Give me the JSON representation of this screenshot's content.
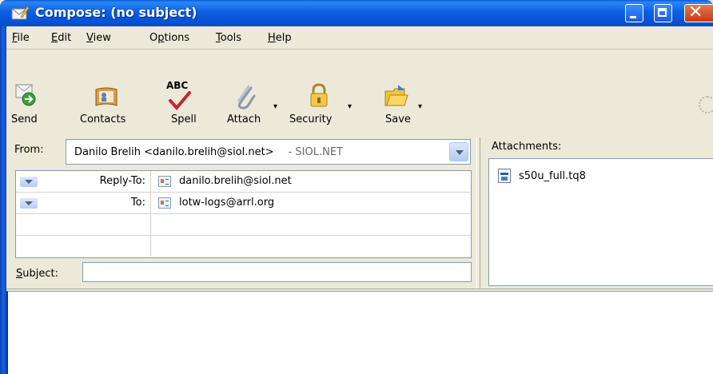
{
  "window": {
    "title": "Compose: (no subject)"
  },
  "menu": {
    "items": [
      {
        "label": "File",
        "accel": "F"
      },
      {
        "label": "Edit",
        "accel": "E"
      },
      {
        "label": "View",
        "accel": "V"
      },
      {
        "label": "Options",
        "accel": "p"
      },
      {
        "label": "Tools",
        "accel": "T"
      },
      {
        "label": "Help",
        "accel": "H"
      }
    ]
  },
  "toolbar": {
    "buttons": [
      {
        "label": "Send",
        "icon": "send-icon"
      },
      {
        "label": "Contacts",
        "icon": "contacts-icon"
      },
      {
        "label": "Spell",
        "icon": "spell-icon"
      },
      {
        "label": "Attach",
        "icon": "attach-icon"
      },
      {
        "label": "Security",
        "icon": "security-icon"
      },
      {
        "label": "Save",
        "icon": "save-icon"
      }
    ],
    "spell_glyph": "ABC"
  },
  "header": {
    "from_label": "From:",
    "from_name": "Danilo Brelih <danilo.brelih@siol.net>",
    "from_account": "- SIOL.NET",
    "recipients": [
      {
        "type": "Reply-To:",
        "address": "danilo.brelih@siol.net"
      },
      {
        "type": "To:",
        "address": "lotw-logs@arrl.org"
      },
      {
        "type": "",
        "address": ""
      },
      {
        "type": "",
        "address": ""
      }
    ],
    "subject_label": "Subject:",
    "subject_value": ""
  },
  "attachments": {
    "label": "Attachments:",
    "items": [
      {
        "name": "s50u_full.tq8"
      }
    ]
  },
  "colors": {
    "titlebar": "#0d5fe3",
    "chrome": "#ece9d8",
    "field_border": "#7f9db9"
  }
}
